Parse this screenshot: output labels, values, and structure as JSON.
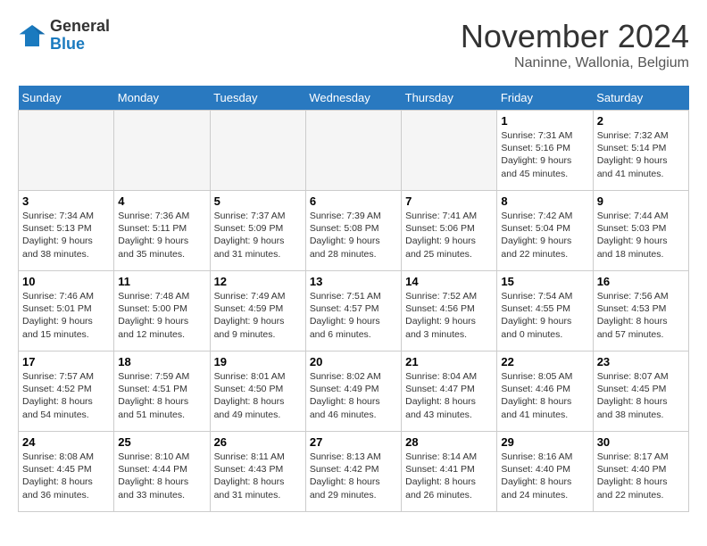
{
  "logo": {
    "general": "General",
    "blue": "Blue"
  },
  "title": "November 2024",
  "location": "Naninne, Wallonia, Belgium",
  "days_of_week": [
    "Sunday",
    "Monday",
    "Tuesday",
    "Wednesday",
    "Thursday",
    "Friday",
    "Saturday"
  ],
  "weeks": [
    [
      {
        "day": "",
        "info": ""
      },
      {
        "day": "",
        "info": ""
      },
      {
        "day": "",
        "info": ""
      },
      {
        "day": "",
        "info": ""
      },
      {
        "day": "",
        "info": ""
      },
      {
        "day": "1",
        "info": "Sunrise: 7:31 AM\nSunset: 5:16 PM\nDaylight: 9 hours\nand 45 minutes."
      },
      {
        "day": "2",
        "info": "Sunrise: 7:32 AM\nSunset: 5:14 PM\nDaylight: 9 hours\nand 41 minutes."
      }
    ],
    [
      {
        "day": "3",
        "info": "Sunrise: 7:34 AM\nSunset: 5:13 PM\nDaylight: 9 hours\nand 38 minutes."
      },
      {
        "day": "4",
        "info": "Sunrise: 7:36 AM\nSunset: 5:11 PM\nDaylight: 9 hours\nand 35 minutes."
      },
      {
        "day": "5",
        "info": "Sunrise: 7:37 AM\nSunset: 5:09 PM\nDaylight: 9 hours\nand 31 minutes."
      },
      {
        "day": "6",
        "info": "Sunrise: 7:39 AM\nSunset: 5:08 PM\nDaylight: 9 hours\nand 28 minutes."
      },
      {
        "day": "7",
        "info": "Sunrise: 7:41 AM\nSunset: 5:06 PM\nDaylight: 9 hours\nand 25 minutes."
      },
      {
        "day": "8",
        "info": "Sunrise: 7:42 AM\nSunset: 5:04 PM\nDaylight: 9 hours\nand 22 minutes."
      },
      {
        "day": "9",
        "info": "Sunrise: 7:44 AM\nSunset: 5:03 PM\nDaylight: 9 hours\nand 18 minutes."
      }
    ],
    [
      {
        "day": "10",
        "info": "Sunrise: 7:46 AM\nSunset: 5:01 PM\nDaylight: 9 hours\nand 15 minutes."
      },
      {
        "day": "11",
        "info": "Sunrise: 7:48 AM\nSunset: 5:00 PM\nDaylight: 9 hours\nand 12 minutes."
      },
      {
        "day": "12",
        "info": "Sunrise: 7:49 AM\nSunset: 4:59 PM\nDaylight: 9 hours\nand 9 minutes."
      },
      {
        "day": "13",
        "info": "Sunrise: 7:51 AM\nSunset: 4:57 PM\nDaylight: 9 hours\nand 6 minutes."
      },
      {
        "day": "14",
        "info": "Sunrise: 7:52 AM\nSunset: 4:56 PM\nDaylight: 9 hours\nand 3 minutes."
      },
      {
        "day": "15",
        "info": "Sunrise: 7:54 AM\nSunset: 4:55 PM\nDaylight: 9 hours\nand 0 minutes."
      },
      {
        "day": "16",
        "info": "Sunrise: 7:56 AM\nSunset: 4:53 PM\nDaylight: 8 hours\nand 57 minutes."
      }
    ],
    [
      {
        "day": "17",
        "info": "Sunrise: 7:57 AM\nSunset: 4:52 PM\nDaylight: 8 hours\nand 54 minutes."
      },
      {
        "day": "18",
        "info": "Sunrise: 7:59 AM\nSunset: 4:51 PM\nDaylight: 8 hours\nand 51 minutes."
      },
      {
        "day": "19",
        "info": "Sunrise: 8:01 AM\nSunset: 4:50 PM\nDaylight: 8 hours\nand 49 minutes."
      },
      {
        "day": "20",
        "info": "Sunrise: 8:02 AM\nSunset: 4:49 PM\nDaylight: 8 hours\nand 46 minutes."
      },
      {
        "day": "21",
        "info": "Sunrise: 8:04 AM\nSunset: 4:47 PM\nDaylight: 8 hours\nand 43 minutes."
      },
      {
        "day": "22",
        "info": "Sunrise: 8:05 AM\nSunset: 4:46 PM\nDaylight: 8 hours\nand 41 minutes."
      },
      {
        "day": "23",
        "info": "Sunrise: 8:07 AM\nSunset: 4:45 PM\nDaylight: 8 hours\nand 38 minutes."
      }
    ],
    [
      {
        "day": "24",
        "info": "Sunrise: 8:08 AM\nSunset: 4:45 PM\nDaylight: 8 hours\nand 36 minutes."
      },
      {
        "day": "25",
        "info": "Sunrise: 8:10 AM\nSunset: 4:44 PM\nDaylight: 8 hours\nand 33 minutes."
      },
      {
        "day": "26",
        "info": "Sunrise: 8:11 AM\nSunset: 4:43 PM\nDaylight: 8 hours\nand 31 minutes."
      },
      {
        "day": "27",
        "info": "Sunrise: 8:13 AM\nSunset: 4:42 PM\nDaylight: 8 hours\nand 29 minutes."
      },
      {
        "day": "28",
        "info": "Sunrise: 8:14 AM\nSunset: 4:41 PM\nDaylight: 8 hours\nand 26 minutes."
      },
      {
        "day": "29",
        "info": "Sunrise: 8:16 AM\nSunset: 4:40 PM\nDaylight: 8 hours\nand 24 minutes."
      },
      {
        "day": "30",
        "info": "Sunrise: 8:17 AM\nSunset: 4:40 PM\nDaylight: 8 hours\nand 22 minutes."
      }
    ]
  ]
}
